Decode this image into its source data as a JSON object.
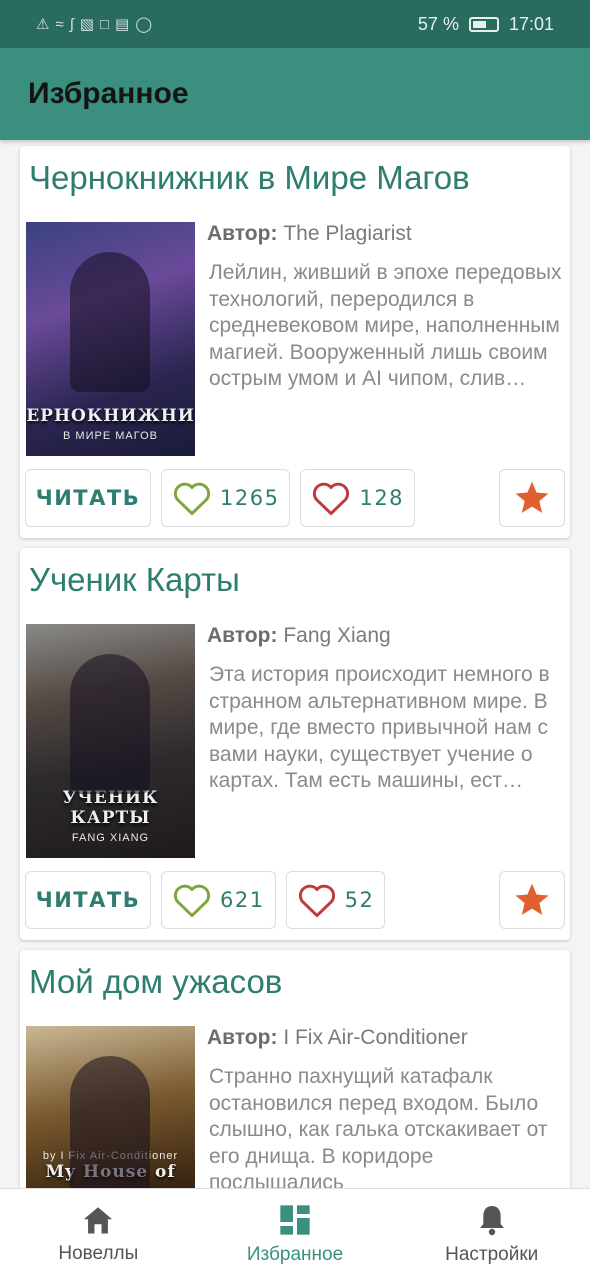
{
  "status_bar": {
    "battery": "57 %",
    "time": "17:01"
  },
  "app_bar": {
    "title": "Избранное"
  },
  "cards": [
    {
      "title": "Чернокнижник в Мире Магов",
      "author_label": "Автор:",
      "author": "The Plagiarist",
      "cover_title": "ЧЕРНОКНИЖНИК",
      "cover_sub": "В МИРЕ МАГОВ",
      "description": "Лейлин, живший в эпохе передовых технологий, переродился в средневековом мире, наполненным магией. Вооруженный лишь своим острым умом и AI чипом, слив…",
      "read_label": "ЧИТАТЬ",
      "likes": "1265",
      "dislikes": "128"
    },
    {
      "title": "Ученик Карты",
      "author_label": "Автор:",
      "author": "Fang Xiang",
      "cover_title": "УЧЕНИК КАРТЫ",
      "cover_sub": "FANG XIANG",
      "description": "Эта история происходит немного в странном альтернативном мире. В мире, где вместо привычной нам с вами науки, существует учение о картах. Там есть машины, ест…",
      "read_label": "ЧИТАТЬ",
      "likes": "621",
      "dislikes": "52"
    },
    {
      "title": "Мой дом ужасов",
      "author_label": "Автор:",
      "author": "I Fix Air-Conditioner",
      "cover_title": "My House of",
      "cover_sub": "by I Fix Air-Conditioner",
      "description": "Странно пахнущий катафалк остановился перед входом. Было слышно, как галька отскакивает от его днища. В коридоре послышались"
    }
  ],
  "bottom_nav": [
    {
      "label": "Новеллы",
      "icon": "home-icon"
    },
    {
      "label": "Избранное",
      "icon": "dashboard-icon",
      "active": true
    },
    {
      "label": "Настройки",
      "icon": "bell-icon"
    }
  ],
  "colors": {
    "status_bar": "#2a6b5f",
    "app_bar": "#3a8f7f",
    "accent": "#2e7d70",
    "like_green": "#7aa63c",
    "dislike_red": "#c0393b",
    "star_orange": "#e06030"
  }
}
